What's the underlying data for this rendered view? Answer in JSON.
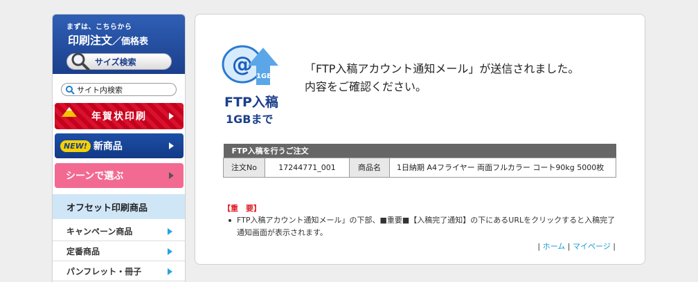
{
  "sidebar": {
    "order_box": {
      "pre_text": "まずは、こちらから",
      "main_text": "印刷注文",
      "sub_text": "／価格表",
      "size_search_label": "サイズ検索"
    },
    "site_search_label": "サイト内検索",
    "banners": {
      "nenga": "年賀状印刷",
      "new_badge": "NEW!",
      "shinshohin": "新商品",
      "scene": "シーンで選ぶ"
    },
    "offset_heading": "オフセット印刷商品",
    "menu": [
      {
        "label": "キャンペーン商品"
      },
      {
        "label": "定番商品"
      },
      {
        "label": "パンフレット・冊子"
      }
    ]
  },
  "main": {
    "logo": {
      "size_badge": "1GB",
      "title": "FTP入稿",
      "subtitle": "1GBまで"
    },
    "message_line1": "「FTP入稿アカウント通知メール」が送信されました。",
    "message_line2": "内容をご確認ください。",
    "table": {
      "header": "FTP入稿を行うご注文",
      "order_no_label": "注文No",
      "order_no_value": "17244771_001",
      "product_label": "商品名",
      "product_value": "1日納期 A4フライヤー 両面フルカラー コート90kg 5000枚"
    },
    "important": {
      "title": "【重　要】",
      "line1": "FTP入稿アカウント通知メール」の下部、■重要■【入稿完了通知】の下にあるURLをクリックすると入稿完了",
      "line2": "通知画面が表示されます。"
    },
    "footer": {
      "sep": "|",
      "home": "ホーム",
      "mypage": "マイページ"
    }
  },
  "colors": {
    "brand_blue": "#1b3f8c",
    "link_blue": "#1a9ad6",
    "alert_red": "#e0202a",
    "scene_pink": "#f26a92",
    "nenga_red": "#c4001a"
  }
}
